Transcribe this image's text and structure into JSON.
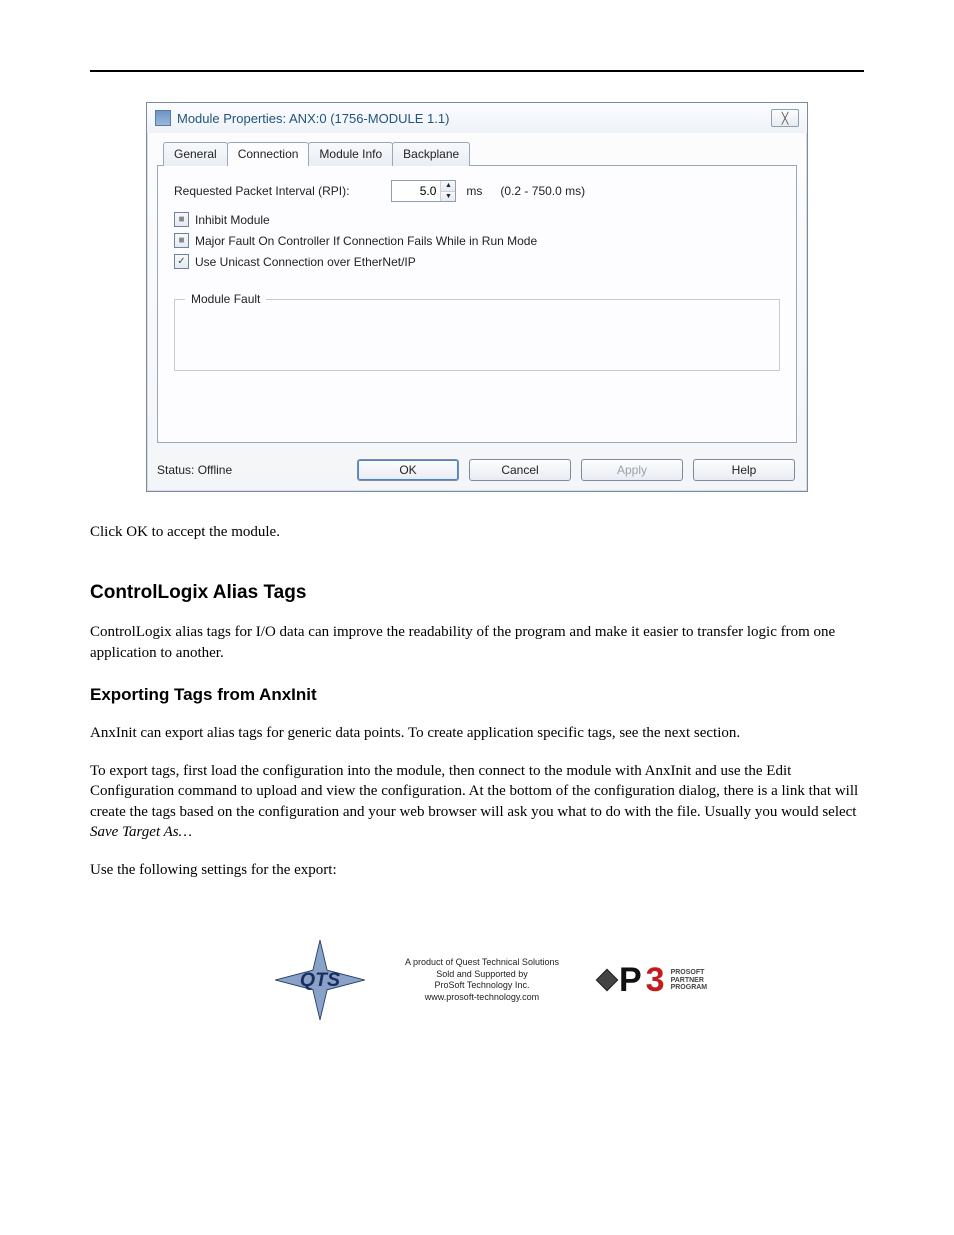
{
  "header_rule_present": true,
  "dialog": {
    "title": "Module Properties: ANX:0 (1756-MODULE 1.1)",
    "close_glyph": "╳",
    "tabs": [
      "General",
      "Connection",
      "Module Info",
      "Backplane"
    ],
    "active_tab_index": 1,
    "rpi_label": "Requested Packet Interval (RPI):",
    "rpi_value": "5.0",
    "rpi_unit": "ms",
    "rpi_range": "(0.2 - 750.0 ms)",
    "chk_inhibit": {
      "label": "Inhibit Module",
      "state": "tristate"
    },
    "chk_fault": {
      "label": "Major Fault On Controller If Connection Fails While in Run Mode",
      "state": "tristate"
    },
    "chk_unicast": {
      "label": "Use Unicast Connection over EtherNet/IP",
      "state": "checked"
    },
    "group_legend": "Module Fault",
    "status_label": "Status:  Offline",
    "buttons": {
      "ok": "OK",
      "cancel": "Cancel",
      "apply": "Apply",
      "help": "Help"
    }
  },
  "body": {
    "p1": "Click OK to accept the module.",
    "h2": "ControlLogix Alias Tags",
    "p2": "ControlLogix alias tags for I/O data can improve the readability of the program and make it easier to transfer logic from one application to another.",
    "h3": "Exporting Tags from AnxInit",
    "p3a": "AnxInit can export alias tags for generic data points.  To create application specific tags, see the next section.",
    "p3b_prefix": "To export tags, first load the configuration into the module, then connect to the module with AnxInit and use the Edit Configuration command to upload and view the configuration.  At the bottom of the configuration dialog, there is a link that will create the tags based on the configuration and your web browser will ask you what to do with the file.  Usually you  would select ",
    "p3b_italic": "Save Target As…",
    "p3b_suffix": " ",
    "p4": "Use the following settings for the export:"
  },
  "footer": {
    "line1": "A product of Quest Technical Solutions",
    "line2": "Sold and Supported by",
    "line3": "ProSoft Technology Inc.",
    "line4": "www.prosoft-technology.com",
    "p3_lines": [
      "PROSOFT",
      "PARTNER",
      "PROGRAM"
    ]
  }
}
